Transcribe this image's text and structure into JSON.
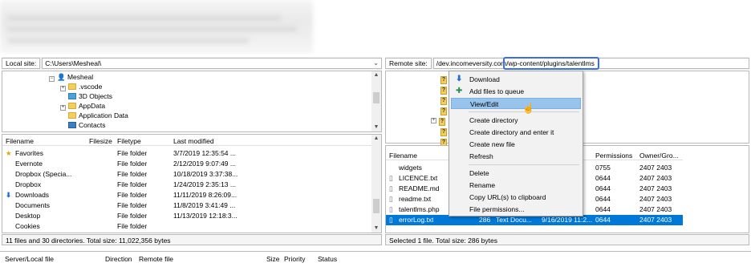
{
  "local": {
    "site_label": "Local site:",
    "path": "C:\\Users\\Mesheal\\",
    "tree": [
      {
        "label": "Mesheal"
      },
      {
        "label": ".vscode"
      },
      {
        "label": "3D Objects"
      },
      {
        "label": "AppData"
      },
      {
        "label": "Application Data"
      },
      {
        "label": "Contacts"
      }
    ],
    "columns": [
      "Filename",
      "Filesize",
      "Filetype",
      "Last modified"
    ],
    "files": [
      {
        "name": "Favorites",
        "type": "File folder",
        "modified": "3/7/2019 12:35:54 ..."
      },
      {
        "name": "Evernote",
        "type": "File folder",
        "modified": "2/12/2019 9:07:49 ..."
      },
      {
        "name": "Dropbox (Specia...",
        "type": "File folder",
        "modified": "10/18/2019 3:37:38..."
      },
      {
        "name": "Dropbox",
        "type": "File folder",
        "modified": "1/24/2019 2:35:13 ..."
      },
      {
        "name": "Downloads",
        "type": "File folder",
        "modified": "11/11/2019 8:26:09..."
      },
      {
        "name": "Documents",
        "type": "File folder",
        "modified": "11/8/2019 3:41:49 ..."
      },
      {
        "name": "Desktop",
        "type": "File folder",
        "modified": "11/13/2019 12:18:3..."
      },
      {
        "name": "Cookies",
        "type": "File folder",
        "modified": ""
      }
    ],
    "status": "11 files and 30 directories. Total size: 11,022,356 bytes"
  },
  "remote": {
    "site_label": "Remote site:",
    "path_prefix": "/dev.incomeversity.com",
    "path_highlight": "/wp-content/plugins/talentlms",
    "columns": [
      "Filename",
      "Permissions",
      "Owner/Gro..."
    ],
    "files": [
      {
        "name": "widgets",
        "perm": "0755",
        "owner": "2407 2403"
      },
      {
        "name": "LICENCE.txt",
        "perm": "0644",
        "owner": "2407 2403"
      },
      {
        "name": "README.md",
        "perm": "0644",
        "owner": "2407 2403"
      },
      {
        "name": "readme.txt",
        "perm": "0644",
        "owner": "2407 2403"
      },
      {
        "name": "talentlms.php",
        "perm": "0644",
        "owner": "2407 2403"
      },
      {
        "name": "errorLog.txt",
        "size": "286",
        "type": "Text Docu...",
        "modified": "9/16/2019 11:2...",
        "perm": "0644",
        "owner": "2407 2403"
      }
    ],
    "status": "Selected 1 file. Total size: 286 bytes"
  },
  "context_menu": {
    "items": [
      "Download",
      "Add files to queue",
      "View/Edit",
      "Create directory",
      "Create directory and enter it",
      "Create new file",
      "Refresh",
      "Delete",
      "Rename",
      "Copy URL(s) to clipboard",
      "File permissions..."
    ],
    "highlighted": "View/Edit"
  },
  "queue": {
    "columns": [
      "Server/Local file",
      "Direction",
      "Remote file",
      "Size",
      "Priority",
      "Status"
    ]
  }
}
